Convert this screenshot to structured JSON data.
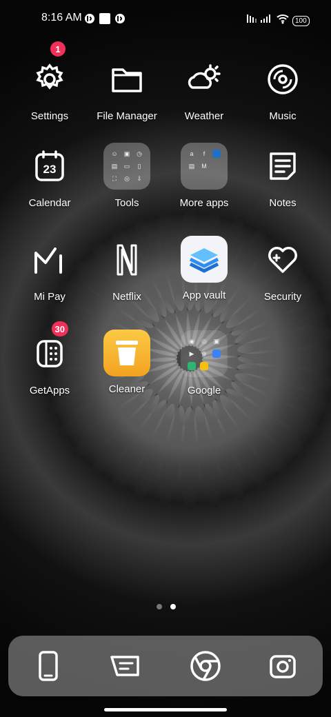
{
  "status_bar": {
    "time": "8:16 AM",
    "battery": "100"
  },
  "apps": [
    {
      "label": "Settings",
      "badge": "1",
      "icon": "gear-icon"
    },
    {
      "label": "File Manager",
      "icon": "folder-icon"
    },
    {
      "label": "Weather",
      "icon": "weather-icon"
    },
    {
      "label": "Music",
      "icon": "music-disc-icon"
    },
    {
      "label": "Calendar",
      "icon": "calendar-icon",
      "date": "23"
    },
    {
      "label": "Tools",
      "icon": "tools-folder"
    },
    {
      "label": "More apps",
      "icon": "more-apps-folder"
    },
    {
      "label": "Notes",
      "icon": "notes-icon"
    },
    {
      "label": "Mi Pay",
      "icon": "mi-pay-icon"
    },
    {
      "label": "Netflix",
      "icon": "netflix-icon"
    },
    {
      "label": "App vault",
      "icon": "app-vault-icon"
    },
    {
      "label": "Security",
      "icon": "security-icon"
    },
    {
      "label": "GetApps",
      "badge": "30",
      "icon": "getapps-icon"
    },
    {
      "label": "Cleaner",
      "icon": "cleaner-icon"
    },
    {
      "label": "Google",
      "icon": "google-folder"
    }
  ],
  "dock": [
    "phone-icon",
    "messages-icon",
    "chrome-icon",
    "camera-icon"
  ],
  "colors": {
    "badge": "#f0305a",
    "cleaner": "#f7b731",
    "vault": "#2f8ff0"
  }
}
